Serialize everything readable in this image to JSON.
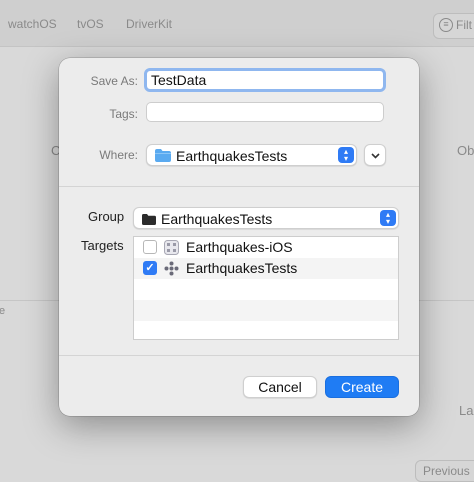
{
  "background": {
    "tabs": [
      "watchOS",
      "tvOS",
      "DriverKit"
    ],
    "filter_label": "Filt",
    "left_fragment_1": "C",
    "right_fragment_1": "Ob",
    "left_fragment_2": "e",
    "right_fragment_2": "La",
    "previous_button": "Previous"
  },
  "dialog": {
    "save_as_label": "Save As:",
    "save_as_value": "TestData",
    "tags_label": "Tags:",
    "tags_value": "",
    "where_label": "Where:",
    "where_value": "EarthquakesTests",
    "group_label": "Group",
    "group_value": "EarthquakesTests",
    "targets_label": "Targets",
    "targets": [
      {
        "name": "Earthquakes-iOS",
        "checked": false
      },
      {
        "name": "EarthquakesTests",
        "checked": true
      }
    ],
    "cancel_label": "Cancel",
    "create_label": "Create"
  },
  "colors": {
    "accent": "#2f7bf5",
    "focus_ring": "#8fb7ef",
    "folder": "#5aaaf0"
  }
}
